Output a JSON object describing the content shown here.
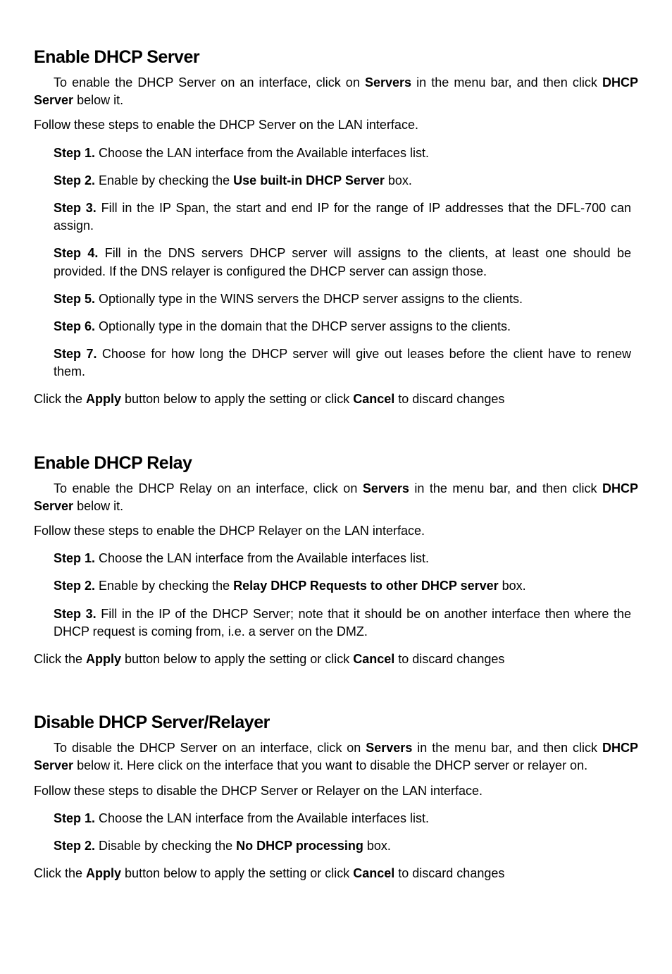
{
  "section1": {
    "title": "Enable DHCP Server",
    "intro_pre": "To enable the DHCP Server on an interface, click on ",
    "intro_bold1": "Servers",
    "intro_mid": " in the menu bar, and then click ",
    "intro_bold2": "DHCP Server",
    "intro_post": " below it.",
    "follow": "Follow these steps to enable the DHCP Server on the LAN interface.",
    "steps": {
      "s1_label": "Step 1.",
      "s1_text": " Choose the LAN interface from the Available interfaces list.",
      "s2_label": "Step 2.",
      "s2_text_pre": " Enable by checking the ",
      "s2_bold": "Use built-in DHCP Server",
      "s2_text_post": " box.",
      "s3_label": "Step 3.",
      "s3_text": " Fill in the IP Span, the start and end IP for the range of IP addresses that the DFL-700 can assign.",
      "s4_label": "Step 4.",
      "s4_text": " Fill in the DNS servers DHCP server will assigns to the clients, at least one should be provided. If the DNS relayer is configured the DHCP server can assign those.",
      "s5_label": "Step 5.",
      "s5_text": " Optionally type in the WINS servers the DHCP server assigns to the clients.",
      "s6_label": "Step 6.",
      "s6_text": " Optionally type in the domain that the DHCP server assigns to the clients.",
      "s7_label": "Step 7.",
      "s7_text": " Choose for how long the DHCP server will give out leases before the client have to renew them."
    },
    "apply_pre": "Click the ",
    "apply_bold1": "Apply",
    "apply_mid": " button below to apply the setting or click ",
    "apply_bold2": "Cancel",
    "apply_post": " to discard changes"
  },
  "section2": {
    "title": "Enable DHCP Relay",
    "intro_pre": "To enable the DHCP Relay on an interface, click on ",
    "intro_bold1": "Servers",
    "intro_mid": " in the menu bar, and then click ",
    "intro_bold2": "DHCP Server",
    "intro_post": " below it.",
    "follow": "Follow these steps to enable the DHCP Relayer on the LAN interface.",
    "steps": {
      "s1_label": "Step 1.",
      "s1_text": " Choose the LAN interface from the Available interfaces list.",
      "s2_label": "Step 2.",
      "s2_text_pre": " Enable by checking the ",
      "s2_bold": "Relay DHCP Requests to other DHCP server",
      "s2_text_post": " box.",
      "s3_label": "Step 3.",
      "s3_text": " Fill in the IP of the DHCP Server; note that it should be on another interface then where the DHCP request is coming from, i.e. a server on the DMZ."
    },
    "apply_pre": "Click the ",
    "apply_bold1": "Apply",
    "apply_mid": " button below to apply the setting or click ",
    "apply_bold2": "Cancel",
    "apply_post": " to discard changes"
  },
  "section3": {
    "title": "Disable DHCP Server/Relayer",
    "intro_pre": "To disable the DHCP Server on an interface, click on ",
    "intro_bold1": "Servers",
    "intro_mid": " in the menu bar, and then click ",
    "intro_bold2": "DHCP Server",
    "intro_post": " below it.  Here click on the interface that you want to disable the DHCP server or relayer on.",
    "follow": "Follow these steps to disable the DHCP Server or Relayer on the LAN interface.",
    "steps": {
      "s1_label": "Step 1.",
      "s1_text": " Choose the LAN interface from the Available interfaces list.",
      "s2_label": "Step 2.",
      "s2_text_pre": " Disable by checking the ",
      "s2_bold": "No DHCP processing",
      "s2_text_post": " box."
    },
    "apply_pre": "Click the ",
    "apply_bold1": "Apply",
    "apply_mid": " button below to apply the setting or click ",
    "apply_bold2": "Cancel",
    "apply_post": " to discard changes"
  }
}
